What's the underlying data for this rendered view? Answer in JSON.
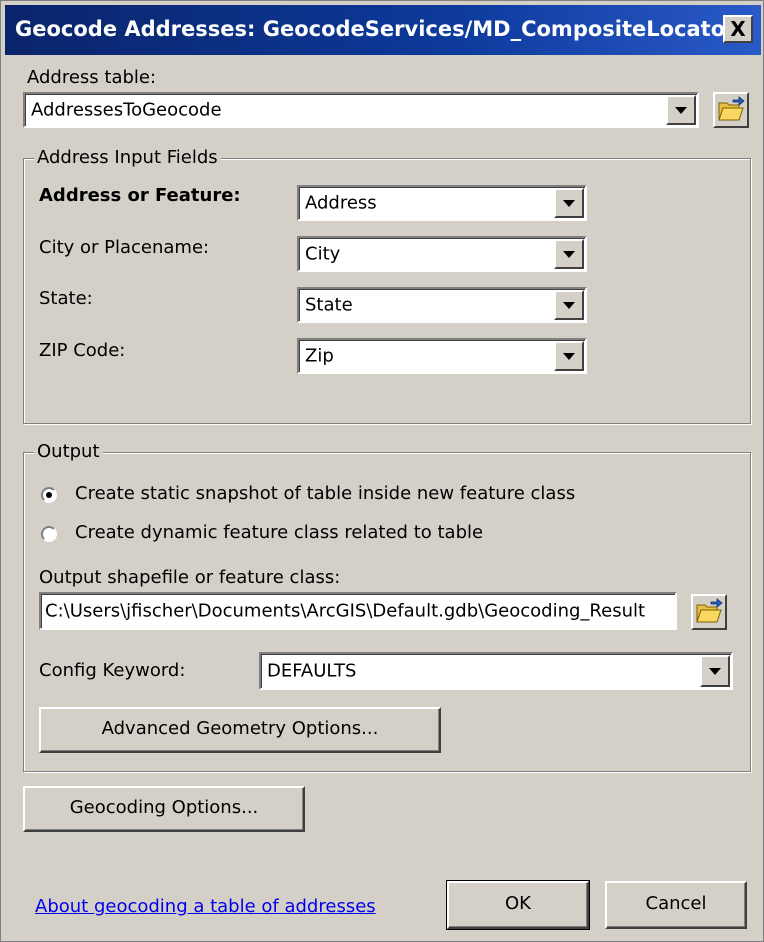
{
  "window": {
    "title": "Geocode Addresses:  GeocodeServices/MD_CompositeLocator",
    "close_label": "X"
  },
  "address_table": {
    "label": "Address table:",
    "value": "AddressesToGeocode"
  },
  "input_fields": {
    "group_label": "Address Input Fields",
    "rows": [
      {
        "label": "Address or Feature:",
        "value": "Address"
      },
      {
        "label": "City or Placename:",
        "value": "City"
      },
      {
        "label": "State:",
        "value": "State"
      },
      {
        "label": "ZIP Code:",
        "value": "Zip"
      }
    ]
  },
  "output": {
    "group_label": "Output",
    "radio_static": "Create static snapshot of table inside new feature class",
    "radio_dynamic": "Create dynamic feature class related to table",
    "selected": "static",
    "path_label": "Output shapefile or feature class:",
    "path_value": "C:\\Users\\jfischer\\Documents\\ArcGIS\\Default.gdb\\Geocoding_Result",
    "config_label": "Config Keyword:",
    "config_value": "DEFAULTS",
    "advanced_button": "Advanced Geometry Options..."
  },
  "footer": {
    "geocoding_options_button": "Geocoding Options...",
    "help_link": "About geocoding a table of addresses",
    "ok_button": "OK",
    "cancel_button": "Cancel"
  },
  "icons": {
    "browse": "folder-open-icon",
    "dropdown": "chevron-down-icon"
  }
}
